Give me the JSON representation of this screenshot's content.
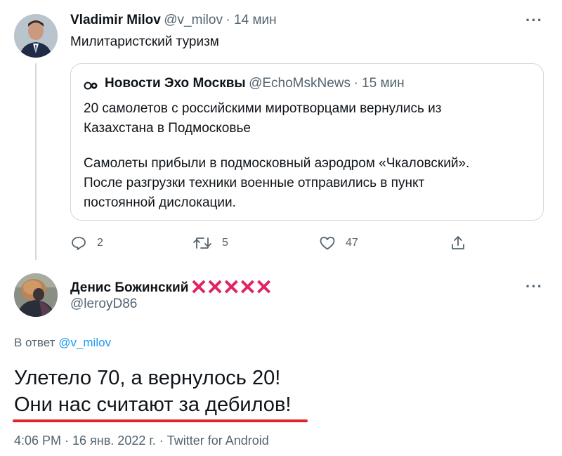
{
  "tweet1": {
    "author_name": "Vladimir Milov",
    "author_handle": "@v_milov",
    "time": "· 14 мин",
    "text": "Милитаристский туризм",
    "menu": "···",
    "quote": {
      "source_name": "Новости Эхо Москвы",
      "source_handle": "@EchoMskNews",
      "time": "· 15 мин",
      "paragraph1_line1": "20 самолетов с российскими миротворцами вернулись из",
      "paragraph1_line2": "Казахстана в Подмосковье",
      "paragraph2_line1": "Самолеты прибыли в подмосковный аэродром «Чкаловский».",
      "paragraph2_line2": "После разгрузки техники военные отправились в пункт",
      "paragraph2_line3": "постоянной дислокации."
    },
    "actions": {
      "replies": "2",
      "retweets": "5",
      "likes": "47"
    }
  },
  "tweet2": {
    "author_name": "Денис Божинский",
    "author_marks": "✕✕✕✕✕",
    "author_handle": "@leroyD86",
    "menu": "···",
    "reply_prefix": "В ответ",
    "reply_to": "@v_milov",
    "line1": "Улетело 70, а вернулось 20!",
    "line2": "Они нас считают за дебилов!",
    "meta": "4:06 PM · 16 янв. 2022 г. · Twitter for Android"
  },
  "colors": {
    "accent": "#1d9bf0",
    "secondary_text": "#536471",
    "underline": "#e0242f",
    "marks": "#e0245e"
  },
  "icons": [
    "reply-icon",
    "retweet-icon",
    "like-icon",
    "share-icon",
    "more-icon",
    "echo-logo-icon"
  ]
}
